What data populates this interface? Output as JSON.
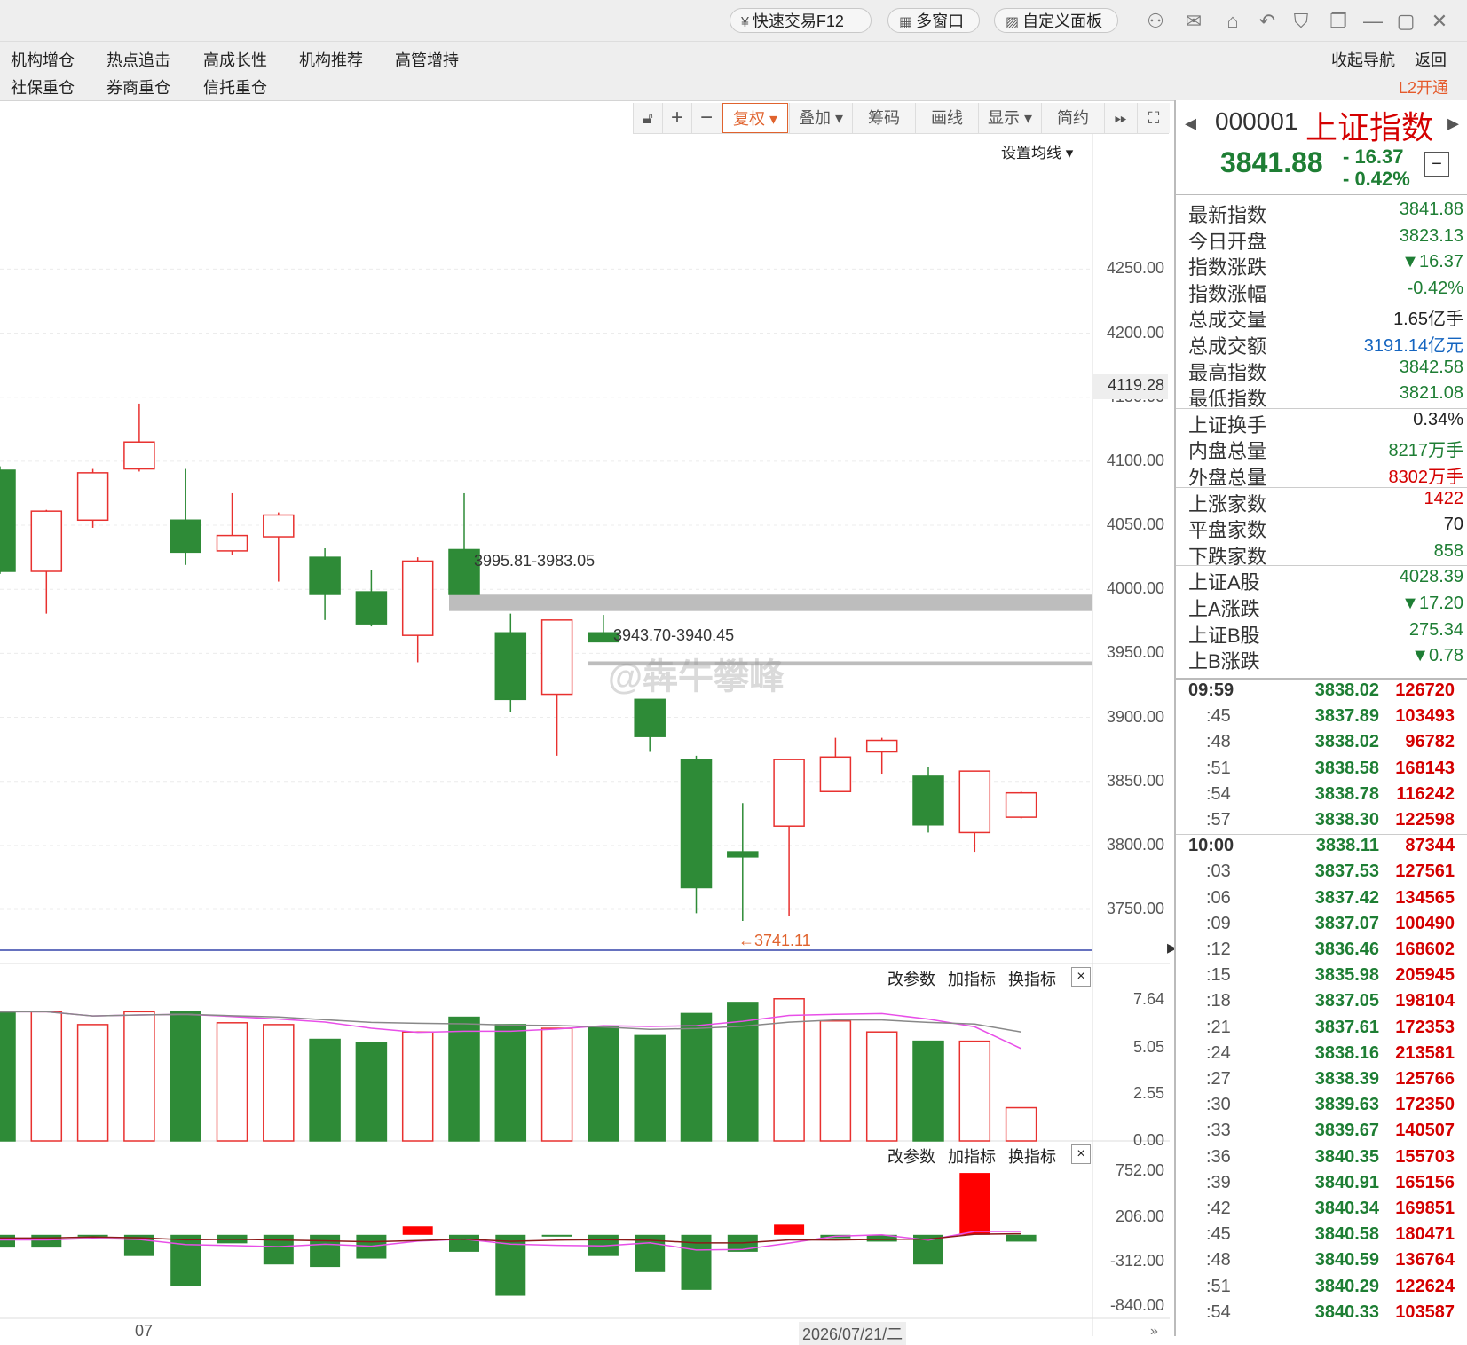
{
  "topbar": {
    "quick_trade": "快速交易F12",
    "multi_window": "多窗口",
    "custom_panel": "自定义面板"
  },
  "nav": {
    "row1": [
      "机构增仓",
      "热点追击",
      "高成长性",
      "机构推荐",
      "高管增持"
    ],
    "row2": [
      "社保重仓",
      "券商重仓",
      "信托重仓"
    ],
    "collapse": "收起导航",
    "back": "返回",
    "l2": "L2开通"
  },
  "toolbar": {
    "plus": "+",
    "minus": "−",
    "fuquan": "复权",
    "overlay": "叠加",
    "chips": "筹码",
    "draw": "画线",
    "display": "显示",
    "simple": "简约",
    "ma_setting": "设置均线"
  },
  "chart_data": {
    "type": "candlestick",
    "price_axis": [
      "4250.00",
      "4200.00",
      "4150.00",
      "4100.00",
      "4050.00",
      "4000.00",
      "3950.00",
      "3900.00",
      "3850.00",
      "3800.00",
      "3750.00"
    ],
    "price_range": [
      3732,
      4296
    ],
    "current_marker": "4119.28",
    "candles": [
      {
        "o": 4093,
        "c": 4014,
        "h": 4096,
        "l": 4012
      },
      {
        "o": 4014,
        "c": 4061,
        "h": 4062,
        "l": 3981
      },
      {
        "o": 4054,
        "c": 4091,
        "h": 4094,
        "l": 4048
      },
      {
        "o": 4094,
        "c": 4115,
        "h": 4145,
        "l": 4092
      },
      {
        "o": 4054,
        "c": 4029,
        "h": 4094,
        "l": 4019
      },
      {
        "o": 4030,
        "c": 4042,
        "h": 4075,
        "l": 4027
      },
      {
        "o": 4041,
        "c": 4058,
        "h": 4060,
        "l": 4006
      },
      {
        "o": 4025,
        "c": 3996,
        "h": 4032,
        "l": 3976
      },
      {
        "o": 3998,
        "c": 3973,
        "h": 4015,
        "l": 3971
      },
      {
        "o": 3964,
        "c": 4022,
        "h": 4025,
        "l": 3943
      },
      {
        "o": 4031,
        "c": 3996,
        "h": 4075,
        "l": 3996
      },
      {
        "o": 3966,
        "c": 3914,
        "h": 3981,
        "l": 3904
      },
      {
        "o": 3918,
        "c": 3976,
        "h": 3976,
        "l": 3870
      },
      {
        "o": 3966,
        "c": 3959,
        "h": 3980,
        "l": 3959
      },
      {
        "o": 3914,
        "c": 3885,
        "h": 3914,
        "l": 3873
      },
      {
        "o": 3867,
        "c": 3767,
        "h": 3870,
        "l": 3747
      },
      {
        "o": 3795,
        "c": 3791,
        "h": 3833,
        "l": 3741
      },
      {
        "o": 3815,
        "c": 3867,
        "h": 3867,
        "l": 3745
      },
      {
        "o": 3842,
        "c": 3869,
        "h": 3884,
        "l": 3842
      },
      {
        "o": 3873,
        "c": 3882,
        "h": 3884,
        "l": 3856
      },
      {
        "o": 3854,
        "c": 3816,
        "h": 3861,
        "l": 3810
      },
      {
        "o": 3810,
        "c": 3858,
        "h": 3858,
        "l": 3795
      },
      {
        "o": 3822,
        "c": 3841,
        "h": 3842,
        "l": 3821
      }
    ],
    "gap_annotations": [
      "3995.81-3983.05",
      "3943.70-3940.45"
    ],
    "gaps": [
      {
        "top": 3995.81,
        "bottom": 3983.05,
        "from_index": 10
      },
      {
        "top": 3943.7,
        "bottom": 3940.45,
        "from_index": 13
      }
    ],
    "low_marker": "3741.11",
    "low_value": 3741.11,
    "volume_axis": [
      "7.64",
      "5.05",
      "2.55",
      "0.00"
    ],
    "volume_range": [
      0,
      7.64
    ],
    "volumes": [
      7.0,
      7.0,
      6.3,
      7.0,
      7.0,
      6.4,
      6.3,
      5.5,
      5.3,
      5.9,
      6.7,
      6.3,
      6.1,
      6.2,
      5.7,
      6.9,
      7.5,
      7.7,
      6.5,
      5.9,
      5.4,
      5.4,
      1.8
    ],
    "macd_axis": [
      "752.00",
      "206.00",
      "-312.00",
      "-840.00"
    ],
    "macd_range": [
      -840,
      752
    ],
    "macd": [
      -150,
      -150,
      -10,
      -250,
      -600,
      -100,
      -350,
      -380,
      -280,
      100,
      -200,
      -720,
      -10,
      -250,
      -440,
      -650,
      -200,
      120,
      -40,
      -80,
      -350,
      730,
      -80
    ],
    "date_labels": [
      "07",
      "2026/07/21/二"
    ]
  },
  "subchart": {
    "change_params": "改参数",
    "add_indicator": "加指标",
    "switch_indicator": "换指标",
    "close": "×"
  },
  "quote": {
    "code": "000001",
    "name": "上证指数",
    "price": "3841.88",
    "change": "- 16.37",
    "change_pct": "- 0.42%",
    "fields": [
      {
        "k": "最新指数",
        "v": "3841.88",
        "c": "green"
      },
      {
        "k": "今日开盘",
        "v": "3823.13",
        "c": "green"
      },
      {
        "k": "指数涨跌",
        "v": "▼16.37",
        "c": "green"
      },
      {
        "k": "指数涨幅",
        "v": "-0.42%",
        "c": "green"
      },
      {
        "k": "总成交量",
        "v": "1.65亿手",
        "c": "black"
      },
      {
        "k": "总成交额",
        "v": "3191.14亿元",
        "c": "blue"
      },
      {
        "k": "最高指数",
        "v": "3842.58",
        "c": "green"
      },
      {
        "k": "最低指数",
        "v": "3821.08",
        "c": "green"
      },
      {
        "k": "上证换手",
        "v": "0.34%",
        "c": "black"
      },
      {
        "k": "内盘总量",
        "v": "8217万手",
        "c": "green"
      },
      {
        "k": "外盘总量",
        "v": "8302万手",
        "c": "red"
      },
      {
        "k": "上涨家数",
        "v": "1422",
        "c": "red"
      },
      {
        "k": "平盘家数",
        "v": "70",
        "c": "black"
      },
      {
        "k": "下跌家数",
        "v": "858",
        "c": "green"
      },
      {
        "k": "上证A股",
        "v": "4028.39",
        "c": "green"
      },
      {
        "k": "上A涨跌",
        "v": "▼17.20",
        "c": "green"
      },
      {
        "k": "上证B股",
        "v": "275.34",
        "c": "green"
      },
      {
        "k": "上B涨跌",
        "v": "▼0.78",
        "c": "green"
      }
    ],
    "ticks": [
      {
        "t": "09:59",
        "p": "3838.02",
        "v": "126720"
      },
      {
        "t": ":45",
        "p": "3837.89",
        "v": "103493"
      },
      {
        "t": ":48",
        "p": "3838.02",
        "v": "96782"
      },
      {
        "t": ":51",
        "p": "3838.58",
        "v": "168143"
      },
      {
        "t": ":54",
        "p": "3838.78",
        "v": "116242"
      },
      {
        "t": ":57",
        "p": "3838.30",
        "v": "122598"
      },
      {
        "t": "10:00",
        "p": "3838.11",
        "v": "87344"
      },
      {
        "t": ":03",
        "p": "3837.53",
        "v": "127561"
      },
      {
        "t": ":06",
        "p": "3837.42",
        "v": "134565"
      },
      {
        "t": ":09",
        "p": "3837.07",
        "v": "100490"
      },
      {
        "t": ":12",
        "p": "3836.46",
        "v": "168602"
      },
      {
        "t": ":15",
        "p": "3835.98",
        "v": "205945"
      },
      {
        "t": ":18",
        "p": "3837.05",
        "v": "198104"
      },
      {
        "t": ":21",
        "p": "3837.61",
        "v": "172353"
      },
      {
        "t": ":24",
        "p": "3838.16",
        "v": "213581"
      },
      {
        "t": ":27",
        "p": "3838.39",
        "v": "125766"
      },
      {
        "t": ":30",
        "p": "3839.63",
        "v": "172350"
      },
      {
        "t": ":33",
        "p": "3839.67",
        "v": "140507"
      },
      {
        "t": ":36",
        "p": "3840.35",
        "v": "155703"
      },
      {
        "t": ":39",
        "p": "3840.91",
        "v": "165156"
      },
      {
        "t": ":42",
        "p": "3840.34",
        "v": "169851"
      },
      {
        "t": ":45",
        "p": "3840.58",
        "v": "180471"
      },
      {
        "t": ":48",
        "p": "3840.59",
        "v": "136764"
      },
      {
        "t": ":51",
        "p": "3840.29",
        "v": "122624"
      },
      {
        "t": ":54",
        "p": "3840.33",
        "v": "103587"
      }
    ]
  },
  "watermark": "@犇牛攀峰",
  "colors": {
    "up": "#e8312f",
    "down": "#2e8b37",
    "gap": "#bdbdbd"
  }
}
